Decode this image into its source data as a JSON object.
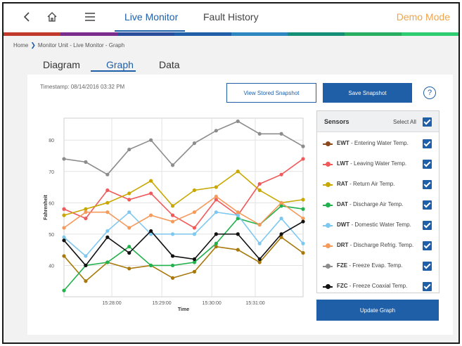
{
  "nav": {
    "back_icon": "chevron-left-icon",
    "home_icon": "home-icon",
    "menu_icon": "hamburger-menu-icon",
    "tabs": [
      {
        "label": "Live Monitor",
        "active": true
      },
      {
        "label": "Fault History",
        "active": false
      }
    ],
    "mode_label": "Demo Mode",
    "accent_color": "#1f5fa8",
    "mode_color": "#f0a44a",
    "stripe_colors": [
      "#c0392b",
      "#7b2d8e",
      "#2a4d9c",
      "#1f5fa8",
      "#2e86c1",
      "#148f77",
      "#27ae60",
      "#2ecc71"
    ]
  },
  "breadcrumb": {
    "home": "Home",
    "path": "Monitor Unit - Live Monitor - Graph"
  },
  "subtabs": [
    {
      "label": "Diagram",
      "active": false
    },
    {
      "label": "Graph",
      "active": true
    },
    {
      "label": "Data",
      "active": false
    }
  ],
  "graph_page": {
    "timestamp": "Timestamp: 08/14/2016 03:32 PM",
    "view_snapshot_label": "View Stored Snapshot",
    "save_snapshot_label": "Save Snapshot",
    "help_label": "?",
    "update_label": "Update Graph"
  },
  "sensors": {
    "title": "Sensors",
    "select_all_label": "Select All",
    "select_all_checked": true,
    "items": [
      {
        "code": "EWT",
        "label": " - Entering Water Temp.",
        "color": "#8b4a1e",
        "checked": true
      },
      {
        "code": "LWT",
        "label": " - Leaving Water Temp.",
        "color": "#f15a5a",
        "checked": true
      },
      {
        "code": "RAT",
        "label": " - Return Air Temp.",
        "color": "#c8a800",
        "checked": true
      },
      {
        "code": "DAT",
        "label": " - Discharge Air Temp.",
        "color": "#22b14c",
        "checked": true
      },
      {
        "code": "DWT",
        "label": " - Domestic Water Temp.",
        "color": "#7ec8f0",
        "checked": true
      },
      {
        "code": "DRT",
        "label": " - Discharge Refrig. Temp.",
        "color": "#f59a5a",
        "checked": true
      },
      {
        "code": "FZE",
        "label": " - Freeze Evap. Temp.",
        "color": "#8c8c8c",
        "checked": true
      },
      {
        "code": "FZC",
        "label": " - Freeze Coaxial Temp.",
        "color": "#111111",
        "checked": true
      }
    ]
  },
  "chart_data": {
    "type": "line",
    "xlabel": "Time",
    "ylabel": "Fahrenheit",
    "x_ticks": [
      {
        "label": "15:28:00",
        "x": 2.2
      },
      {
        "label": "15:29:00",
        "x": 4.5
      },
      {
        "label": "15:30:00",
        "x": 6.8
      },
      {
        "label": "15:31:00",
        "x": 8.8
      }
    ],
    "x": [
      0,
      1,
      2,
      3,
      4,
      5,
      6,
      7,
      8,
      9,
      10,
      11
    ],
    "xlim": [
      0,
      11
    ],
    "ylim": [
      30,
      87
    ],
    "y_ticks": [
      40,
      50,
      60,
      70,
      80
    ],
    "grid": true,
    "series": [
      {
        "name": "EWT",
        "color": "#a8790a",
        "values": [
          43,
          35,
          41,
          39,
          40,
          36,
          38,
          46,
          45,
          41,
          49,
          44
        ]
      },
      {
        "name": "LWT",
        "color": "#f15a5a",
        "values": [
          58,
          55,
          64,
          61,
          63,
          56,
          52,
          61,
          56,
          66,
          69,
          74
        ]
      },
      {
        "name": "RAT",
        "color": "#c8a800",
        "values": [
          56,
          58,
          60,
          63,
          67,
          59,
          64,
          65,
          70,
          64,
          60,
          61
        ]
      },
      {
        "name": "DAT",
        "color": "#22b14c",
        "values": [
          32,
          40,
          41,
          46,
          40,
          40,
          41,
          47,
          55,
          53,
          59,
          58
        ]
      },
      {
        "name": "DWT",
        "color": "#7ec8f0",
        "values": [
          49,
          43,
          51,
          57,
          50,
          50,
          50,
          57,
          56,
          47,
          55,
          47
        ]
      },
      {
        "name": "DRT",
        "color": "#f59a5a",
        "values": [
          52,
          57,
          57,
          52,
          56,
          54,
          57,
          62,
          57,
          53,
          60,
          55
        ]
      },
      {
        "name": "FZE",
        "color": "#8c8c8c",
        "values": [
          74,
          73,
          69,
          77,
          80,
          72,
          79,
          83,
          86,
          82,
          82,
          78
        ]
      },
      {
        "name": "FZC",
        "color": "#111111",
        "values": [
          48,
          40,
          49,
          44,
          51,
          43,
          42,
          50,
          50,
          42,
          50,
          54
        ]
      }
    ]
  }
}
